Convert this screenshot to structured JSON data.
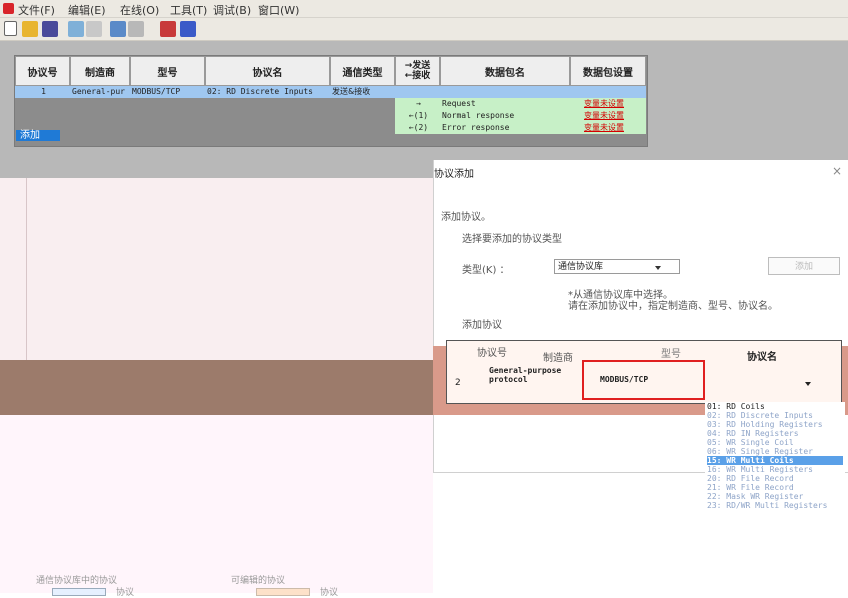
{
  "menubar": {
    "items": [
      "文件(F)",
      "编辑(E)",
      "在线(O)",
      "工具(T)",
      "调试(B)",
      "窗口(W)"
    ]
  },
  "toolbar": {
    "icons": [
      "new-file-icon",
      "open-folder-icon",
      "save-icon",
      "cut-icon",
      "copy-icon",
      "paste-icon",
      "print-icon",
      "upload-icon",
      "download-icon"
    ]
  },
  "protocol_table": {
    "headers": [
      "协议号",
      "制造商",
      "型号",
      "协议名",
      "通信类型",
      "→发送\n←接收",
      "数据包名",
      "数据包设置"
    ],
    "row": {
      "no": "1",
      "manufacturer": "General-pur",
      "model": "MODBUS/TCP",
      "protocol": "02: RD Discrete Inputs",
      "comm_type": "发送&接收"
    },
    "packets": [
      {
        "dir": "→",
        "name": "Request",
        "setting": "变量未设置"
      },
      {
        "dir": "←(1)",
        "name": "Normal response",
        "setting": "变量未设置"
      },
      {
        "dir": "←(2)",
        "name": "Error response",
        "setting": "变量未设置"
      }
    ],
    "add_label": "添加"
  },
  "dialog": {
    "title": "协议添加",
    "close_glyph": "×",
    "heading": "添加协议。",
    "instruction": "选择要添加的协议类型",
    "type_label": "类型(K) ：",
    "type_value": "通信协议库",
    "add_button": "添加",
    "note_line1": "*从通信协议库中选择。",
    "note_line2": "请在添加协议中，指定制造商、型号、协议名。",
    "section_label": "添加协议",
    "table_headers": {
      "no": "协议号",
      "manufacturer": "制造商",
      "model": "型号",
      "protocol": "协议名"
    },
    "row": {
      "no": "2",
      "manufacturer_line1": "General-purpose",
      "manufacturer_line2": "protocol",
      "model": "MODBUS/TCP",
      "protocol": ""
    }
  },
  "dropdown": {
    "items": [
      "01: RD Coils",
      "02: RD Discrete Inputs",
      "03: RD Holding Registers",
      "04: RD IN Registers",
      "05: WR Single Coil",
      "06: WR Single Register",
      "15: WR Multi Coils",
      "16: WR Multi Registers",
      "20: RD File Record",
      "21: WR File Record",
      "22: Mask WR Register",
      "23: RD/WR Multi Registers"
    ],
    "selected_index": 6
  },
  "footer": {
    "library_label": "通信协议库中的协议",
    "editable_label": "可编辑的协议",
    "swatch_library_label": "协议",
    "swatch_editable_label": "协议"
  },
  "colors": {
    "selected_row": "#9fc7f0",
    "packet_row": "#c7f0c7",
    "warning_text": "#d40000",
    "highlight_border": "#e02020",
    "dropdown_selected": "#5aa0e8"
  }
}
